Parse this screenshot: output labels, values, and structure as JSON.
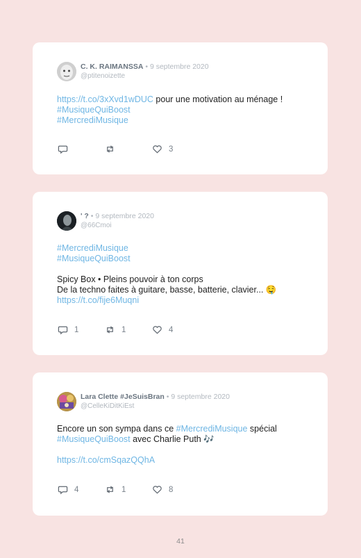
{
  "tweets": [
    {
      "name": "C. K. RAIMANSSA",
      "separator": " • ",
      "date": "9 septembre 2020",
      "handle": "@ptitenoizette",
      "link1": "https://t.co/3xXvd1wDUC",
      "text1": " pour une motivation au ménage !",
      "tag1": "#MusiqueQuiBoost",
      "tag2": "#MercrediMusique",
      "replies": "",
      "retweets": "",
      "likes": "3"
    },
    {
      "name": "' ?",
      "separator": " • ",
      "date": "9 septembre 2020",
      "handle": "@66Cmoi",
      "tag1": "#MercrediMusique",
      "tag2": "#MusiqueQuiBoost",
      "line1": "Spicy Box • Pleins pouvoir à ton corps",
      "line2": "De la techno faites à guitare, basse, batterie, clavier... 🤤",
      "link1": "https://t.co/fije6Muqni",
      "replies": "1",
      "retweets": "1",
      "likes": "4"
    },
    {
      "name": "Lara Clette #JeSuisBran",
      "separator": " • ",
      "date": "9 septembre 2020",
      "handle": "@CelleKiDitKiEst",
      "text1": "Encore un son sympa dans ce ",
      "tag1": "#MercrediMusique",
      "text2": " spécial",
      "tag2": "#MusiqueQuiBoost",
      "text3": " avec Charlie Puth ",
      "emoji": "🎶",
      "link1": "https://t.co/cmSqazQQhA",
      "replies": "4",
      "retweets": "1",
      "likes": "8"
    }
  ],
  "page_number": "41",
  "colors": {
    "background": "#f8e3e2",
    "link": "#6fb6e4",
    "card": "#ffffff"
  }
}
